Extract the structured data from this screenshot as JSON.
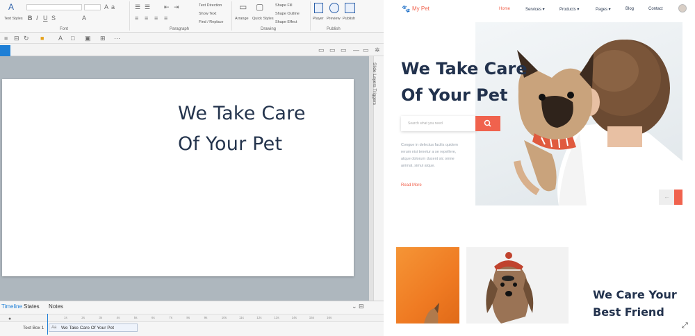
{
  "ribbon": {
    "groups": [
      "Font",
      "Paragraph",
      "Drawing",
      "Publish"
    ],
    "text_styles": "Text Styles",
    "text_direction": "Text Direction",
    "show_text": "Show Text",
    "find_replace": "Find / Replace",
    "arrange": "Arrange",
    "quick_styles": "Quick Styles",
    "shape_fill": "Shape Fill",
    "shape_outline": "Shape Outline",
    "shape_effect": "Shape Effect",
    "player": "Player",
    "preview": "Preview",
    "publish": "Publish"
  },
  "slide": {
    "title_line1": "We Take Care",
    "title_line2": "Of Your Pet"
  },
  "side_panel": {
    "label": "Slide Layers  Triggers"
  },
  "timeline": {
    "tabs": [
      "Timeline",
      "States",
      "Notes"
    ],
    "ruler": [
      "1s",
      "2s",
      "3s",
      "4s",
      "5s",
      "6s",
      "7s",
      "8s",
      "9s",
      "10s",
      "11s",
      "12s",
      "13s",
      "14s",
      "15s",
      "16s"
    ],
    "row_label": "Text Box 1",
    "row_bar_text": "We Take Care Of Your Pet",
    "row_bar_tag": "Aa"
  },
  "preview": {
    "logo": "My Pet",
    "nav": [
      "Home",
      "Services ▾",
      "Products ▾",
      "Pages ▾",
      "Blog",
      "Contact"
    ],
    "hero_title_line1": "We Take Care",
    "hero_title_line2": "Of Your Pet",
    "search_placeholder": "Search what you need",
    "hero_paragraph": "Congue in delectus facilis quidem rerum nisi tenetur a se repellere, atque dolorum ducent sic omne animal, simul atque.",
    "read_more": "Read More",
    "care_line1": "We Care Your",
    "care_line2": "Best Friend"
  },
  "colors": {
    "accent": "#f0624d",
    "navy": "#22324d",
    "editor_blue": "#1e7fd6"
  }
}
